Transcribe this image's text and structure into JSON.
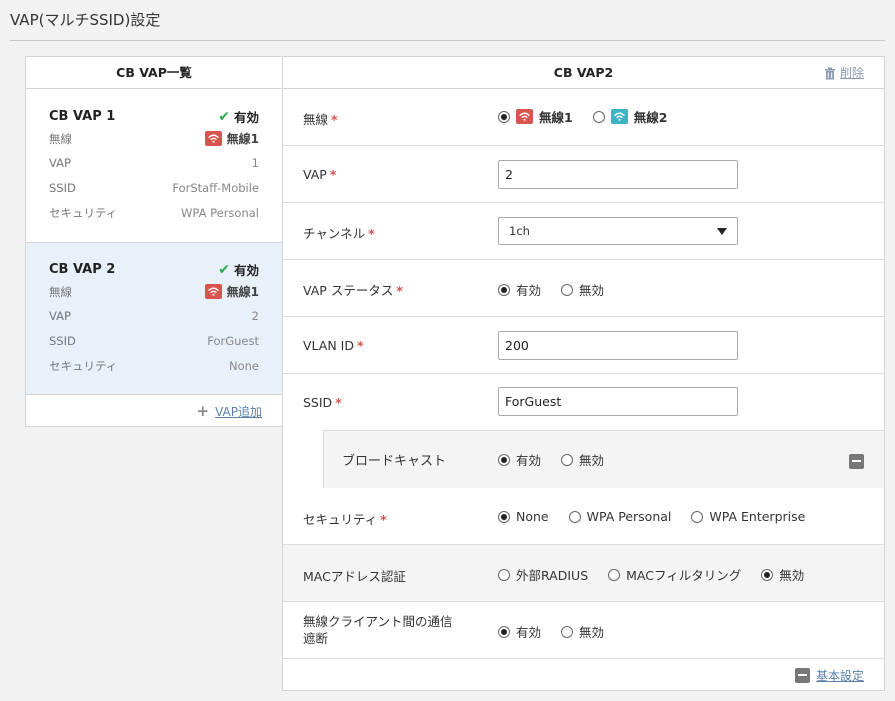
{
  "page": {
    "title": "VAP(マルチSSID)設定"
  },
  "list": {
    "header": "CB VAP一覧",
    "add_label": "VAP追加",
    "labels": {
      "radio": "無線",
      "vap": "VAP",
      "ssid": "SSID",
      "security": "セキュリティ"
    },
    "items": [
      {
        "name": "CB VAP 1",
        "status": "有効",
        "radio": "無線1",
        "vap": "1",
        "ssid": "ForStaff-Mobile",
        "security": "WPA Personal"
      },
      {
        "name": "CB VAP 2",
        "status": "有効",
        "radio": "無線1",
        "vap": "2",
        "ssid": "ForGuest",
        "security": "None"
      }
    ]
  },
  "form": {
    "header": "CB VAP2",
    "delete_label": "削除",
    "radio_label": "無線",
    "radio_options": [
      "無線1",
      "無線2"
    ],
    "vap_label": "VAP",
    "vap_value": "2",
    "channel_label": "チャンネル",
    "channel_value": "1ch",
    "status_label": "VAP ステータス",
    "enabled": "有効",
    "disabled": "無効",
    "vlan_label": "VLAN ID",
    "vlan_value": "200",
    "ssid_label": "SSID",
    "ssid_value": "ForGuest",
    "broadcast_label": "ブロードキャスト",
    "security_label": "セキュリティ",
    "security_options": [
      "None",
      "WPA Personal",
      "WPA Enterprise"
    ],
    "mac_label": "MACアドレス認証",
    "mac_options": [
      "外部RADIUS",
      "MACフィルタリング",
      "無効"
    ],
    "isolation_label_1": "無線クライアント間の通信",
    "isolation_label_2": "遮断",
    "basic_label": "基本設定"
  },
  "colors": {
    "accent_red": "#d9534f",
    "accent_teal": "#3fb3c6",
    "check_green": "#2fa84f",
    "selected_bg": "#e8f0f9"
  }
}
